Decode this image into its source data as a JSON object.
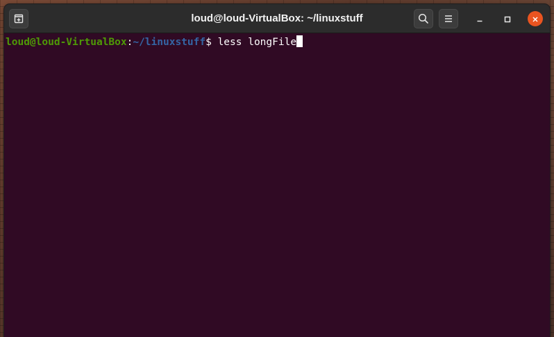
{
  "window": {
    "title": "loud@loud-VirtualBox: ~/linuxstuff"
  },
  "titlebar": {
    "new_tab_icon": "new-tab-icon",
    "search_icon": "search-icon",
    "menu_icon": "hamburger-menu-icon",
    "minimize_icon": "minimize-icon",
    "maximize_icon": "maximize-icon",
    "close_icon": "close-icon",
    "close_color": "#e95420"
  },
  "terminal": {
    "background": "#300a24",
    "prompt_user_host": "loud@loud-VirtualBox",
    "prompt_colon": ":",
    "prompt_path": "~/linuxstuff",
    "prompt_dollar": "$ ",
    "command": "less longFile",
    "user_color": "#4e9a06",
    "path_color": "#3465a4"
  }
}
